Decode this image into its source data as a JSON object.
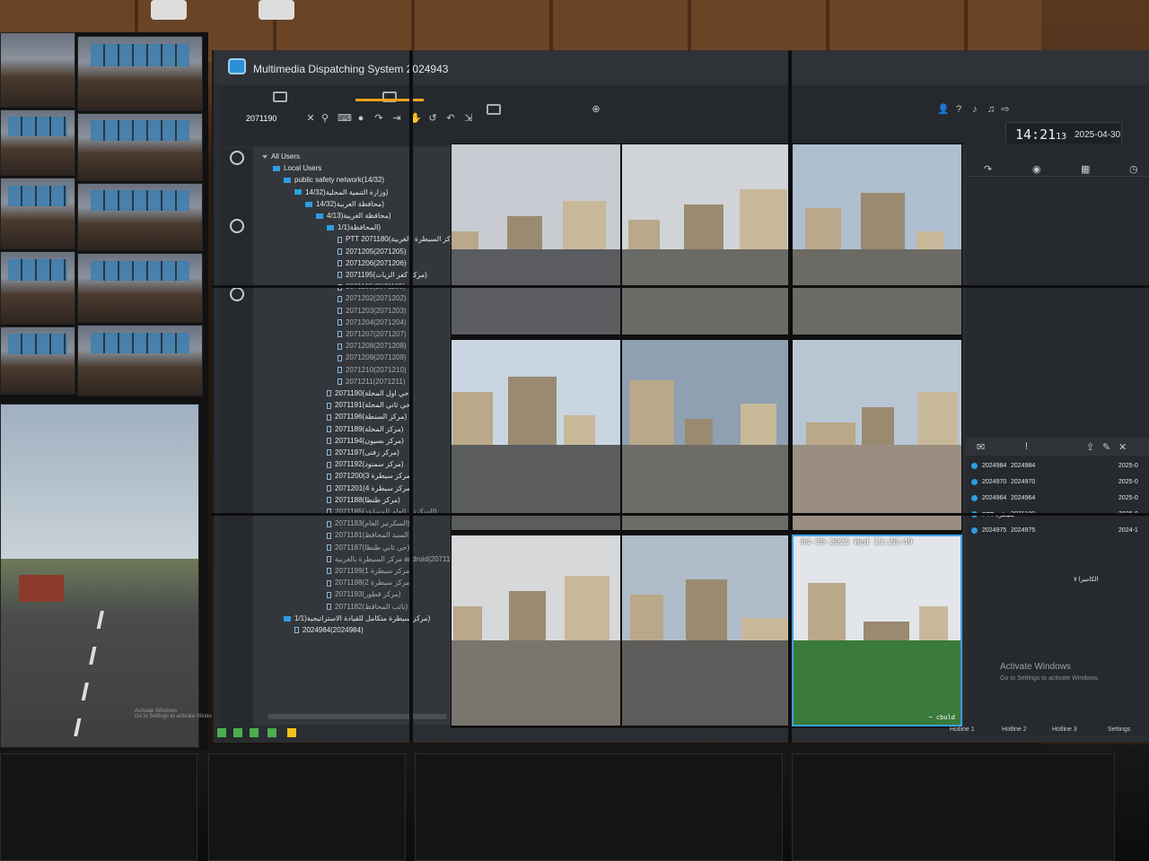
{
  "app": {
    "title": "Multimedia Dispatching System 2024943"
  },
  "toolbar": {
    "search_value": "2071190",
    "tabs": [
      "resources-tab",
      "video-tab",
      "monitor-tab",
      "add-tab"
    ],
    "tools": [
      "close-icon",
      "search-icon",
      "keyboard-icon",
      "mic-icon",
      "call-icon",
      "forward-icon",
      "ptt-icon",
      "hangup-icon",
      "undo-icon",
      "exit-icon"
    ],
    "icons": [
      "user-group-icon",
      "help-icon",
      "volume-icon",
      "bell-icon",
      "phone-icon",
      "exit-icon"
    ]
  },
  "clock": {
    "time": "14:21",
    "seconds": "13",
    "date": "2025-04-30"
  },
  "tree": {
    "rows": [
      {
        "label": "All Users",
        "level": 0,
        "type": "caret"
      },
      {
        "label": "Local Users",
        "level": 1,
        "type": "folder"
      },
      {
        "label": "public safety network(14/32)",
        "level": 2,
        "type": "folder"
      },
      {
        "label": "14/32)وزارة التنمية المحلية)",
        "level": 3,
        "type": "folder"
      },
      {
        "label": "14/32)محافظة الغربية)",
        "level": 4,
        "type": "folder"
      },
      {
        "label": "4/13)محافظة الغربية)",
        "level": 5,
        "type": "folder"
      },
      {
        "label": "1/1)المحافظة)",
        "level": 6,
        "type": "folder"
      },
      {
        "label": "PTT 2071180(مركز السيطرة بالغربية)",
        "level": 7,
        "type": "dev"
      },
      {
        "label": "2071205(2071205)",
        "level": 7,
        "type": "dev"
      },
      {
        "label": "2071206(2071206)",
        "level": 7,
        "type": "dev"
      },
      {
        "label": "2071195(مركز كفر الزيات)",
        "level": 7,
        "type": "dev"
      },
      {
        "label": "2071185(2071185)",
        "level": 7,
        "type": "dev",
        "dim": true
      },
      {
        "label": "2071202(2071202)",
        "level": 7,
        "type": "dev",
        "dim": true
      },
      {
        "label": "2071203(2071203)",
        "level": 7,
        "type": "dev",
        "dim": true
      },
      {
        "label": "2071204(2071204)",
        "level": 7,
        "type": "dev",
        "dim": true
      },
      {
        "label": "2071207(2071207)",
        "level": 7,
        "type": "dev",
        "dim": true
      },
      {
        "label": "2071208(2071208)",
        "level": 7,
        "type": "dev",
        "dim": true
      },
      {
        "label": "2071209(2071209)",
        "level": 7,
        "type": "dev",
        "dim": true
      },
      {
        "label": "2071210(2071210)",
        "level": 7,
        "type": "dev",
        "dim": true
      },
      {
        "label": "2071211(2071211)",
        "level": 7,
        "type": "dev",
        "dim": true
      },
      {
        "label": "2071190(حي اول المحلة)",
        "level": 6,
        "type": "dev"
      },
      {
        "label": "2071191(حي ثاني المحلة)",
        "level": 6,
        "type": "dev"
      },
      {
        "label": "2071196(مركز السنطة)",
        "level": 6,
        "type": "dev"
      },
      {
        "label": "2071189(مركز المحلة)",
        "level": 6,
        "type": "dev"
      },
      {
        "label": "2071194(مركز بسيون)",
        "level": 6,
        "type": "dev"
      },
      {
        "label": "2071197(مركز زفتى)",
        "level": 6,
        "type": "dev"
      },
      {
        "label": "2071192(مركز سمنود)",
        "level": 6,
        "type": "dev"
      },
      {
        "label": "2071200(مركز سيطرة 3)",
        "level": 6,
        "type": "dev"
      },
      {
        "label": "2071201(مركز سيطرة 4)",
        "level": 6,
        "type": "dev"
      },
      {
        "label": "2071188(مركز طنطا)",
        "level": 6,
        "type": "dev"
      },
      {
        "label": "2071185(السكرتير العام المساعد)",
        "level": 6,
        "type": "dev",
        "dim": true
      },
      {
        "label": "2071183(السكرتير العام)",
        "level": 6,
        "type": "dev",
        "dim": true
      },
      {
        "label": "2071181(السيد المحافظ)",
        "level": 6,
        "type": "dev",
        "dim": true
      },
      {
        "label": "2071187(حي ثاني طنطا)",
        "level": 6,
        "type": "dev",
        "dim": true
      },
      {
        "label": "مركز السيطرة بالغربية android(2071184)",
        "level": 6,
        "type": "dev",
        "dim": true
      },
      {
        "label": "2071199(مركز سيطرة 1)",
        "level": 6,
        "type": "dev",
        "dim": true
      },
      {
        "label": "2071198(مركز سيطرة 2)",
        "level": 6,
        "type": "dev",
        "dim": true
      },
      {
        "label": "2071193(مركز قطور)",
        "level": 6,
        "type": "dev",
        "dim": true
      },
      {
        "label": "2071182(نائب المحافظ)",
        "level": 6,
        "type": "dev",
        "dim": true
      },
      {
        "label": "1/1)مركز سيطرة متكامل للقيادة الاستراتيجية)",
        "level": 2,
        "type": "folder"
      },
      {
        "label": "2024984(2024984)",
        "level": 3,
        "type": "dev"
      }
    ]
  },
  "cameras": {
    "selected_osd": "04-30-2025 Wed 13:28:49",
    "selected_osd2": "~ cbuld"
  },
  "right_panel": {
    "rows": [
      {
        "c1": "2024984",
        "c2": "2024984",
        "c3": "2025-0"
      },
      {
        "c1": "2024970",
        "c2": "2024970",
        "c3": "2025-0"
      },
      {
        "c1": "2024964",
        "c2": "2024964",
        "c3": "2025-0"
      },
      {
        "c1": "PTT سيطرة",
        "c2": "2071180",
        "c3": "2025-0"
      },
      {
        "c1": "2024975",
        "c2": "2024975",
        "c3": "2024-1"
      }
    ],
    "row_extra": "الكاميرا ٧",
    "hotlines": [
      "Hotline 1",
      "Hotline 2",
      "Hotline 3",
      "Settings"
    ]
  },
  "watermark": {
    "title": "Activate Windows",
    "subtitle": "Go to Settings to activate Windows."
  },
  "left_wall": {
    "caption_1": "Activate Windows",
    "caption_2": "Go to Settings to activate Windows."
  },
  "colors": {
    "accent": "#f2a21b",
    "selection": "#39a0e8",
    "folder": "#2e9ce0"
  }
}
